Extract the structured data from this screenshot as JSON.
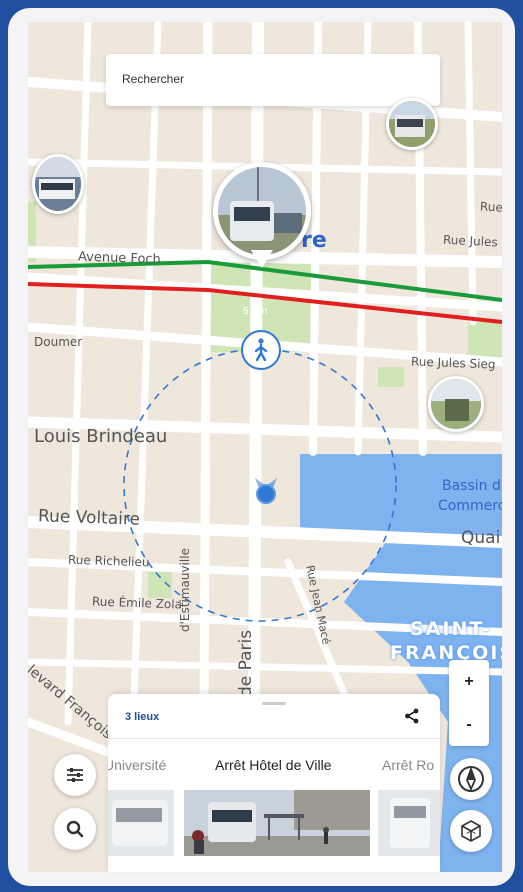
{
  "search": {
    "placeholder": "Rechercher"
  },
  "map": {
    "streets": [
      "Avenue Foch",
      "Rue",
      "Rue Jules",
      "Doumer",
      "Rue Jules Sieg",
      "Louis Brindeau",
      "Rue Voltaire",
      "Rue Richelieu",
      "Rue Émile Zola",
      "d'Estimauville",
      "de Paris",
      "Rue Jean Macé",
      "levard François"
    ],
    "water_labels": [
      "Bassin du",
      "Commerce",
      "Quai"
    ],
    "district": [
      "SAINT-",
      "FRANÇOIS"
    ],
    "square_label": "re",
    "walk_time": "5 min",
    "colors": {
      "green_line": "#1a9b3a",
      "red_line": "#e02020",
      "water": "#7fb3f0",
      "accent": "#2f78d4"
    }
  },
  "icons": {
    "walk": "person-walking-icon",
    "location": "current-location-icon",
    "filter": "sliders-icon",
    "search": "search-icon",
    "compass": "compass-icon",
    "3d": "cube-3d-icon",
    "share": "share-icon"
  },
  "zoom": {
    "in": "+",
    "out": "-"
  },
  "panel": {
    "count": "3 lieux",
    "stops": [
      {
        "name": "Université",
        "state": "previous"
      },
      {
        "name": "Arrêt Hôtel de Ville",
        "state": "current"
      },
      {
        "name": "Arrêt Ro",
        "state": "next"
      }
    ]
  }
}
